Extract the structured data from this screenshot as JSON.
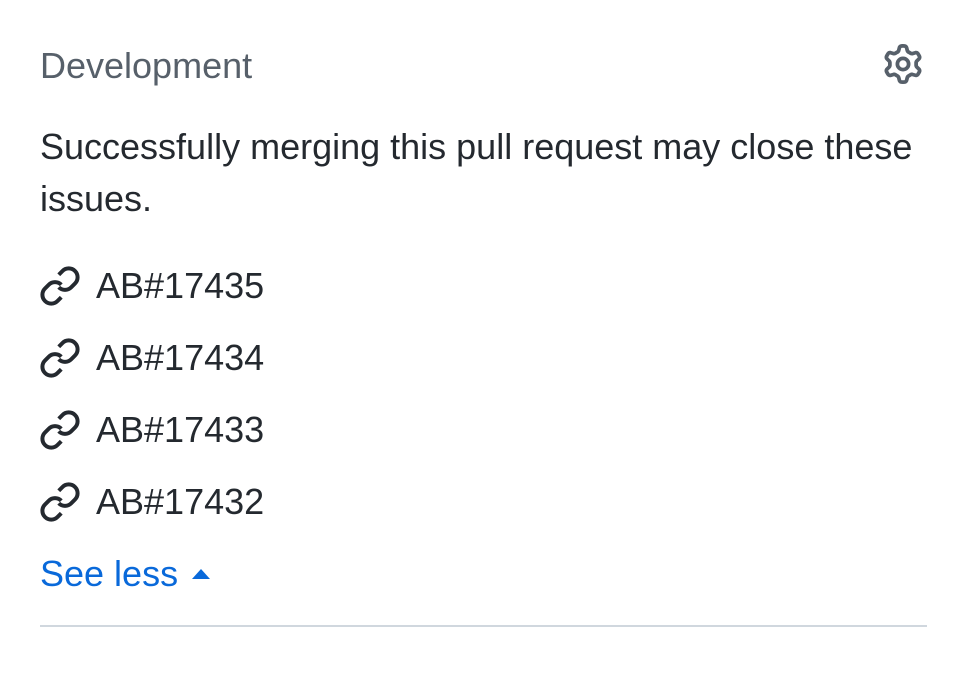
{
  "section": {
    "title": "Development",
    "description": "Successfully merging this pull request may close these issues."
  },
  "linked_items": [
    {
      "label": "AB#17435"
    },
    {
      "label": "AB#17434"
    },
    {
      "label": "AB#17433"
    },
    {
      "label": "AB#17432"
    }
  ],
  "toggle": {
    "label": "See less"
  }
}
